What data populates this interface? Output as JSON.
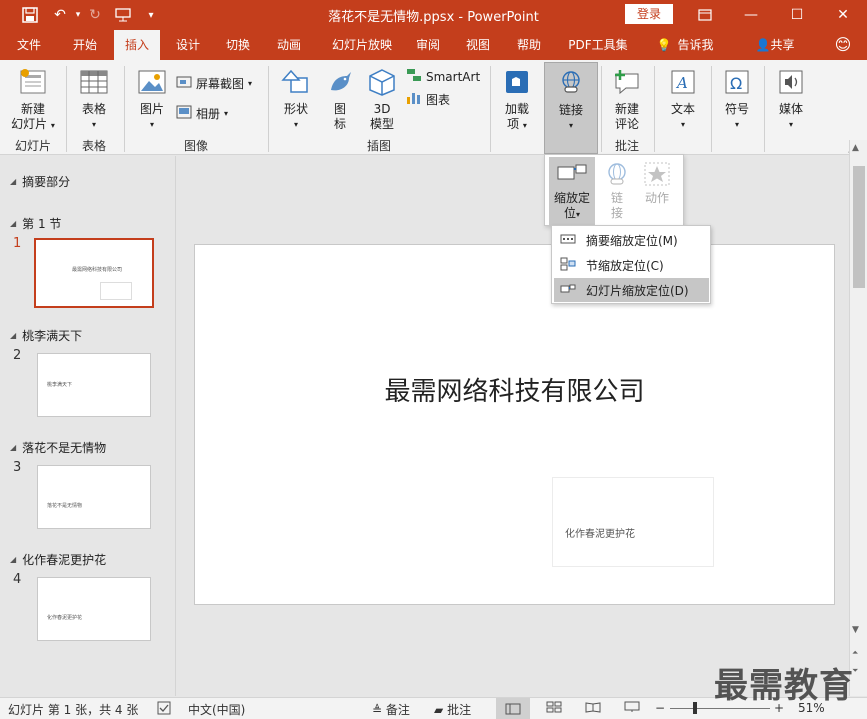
{
  "titlebar": {
    "title": "落花不是无情物.ppsx  -  PowerPoint",
    "login": "登录"
  },
  "tabs": [
    "文件",
    "开始",
    "插入",
    "设计",
    "切换",
    "动画",
    "幻灯片放映",
    "审阅",
    "视图",
    "帮助",
    "PDF工具集",
    "告诉我",
    "共享"
  ],
  "ribbon": {
    "new_slide": "新建\n幻灯片",
    "new_slide_l1": "新建",
    "new_slide_l2": "幻灯片",
    "table": "表格",
    "picture": "图片",
    "screenshot": "屏幕截图",
    "album": "相册",
    "shapes": "形状",
    "icons_l1": "图",
    "icons_l2": "标",
    "model_l1": "3D",
    "model_l2": "模型",
    "smartart": "SmartArt",
    "chart": "图表",
    "addin_l1": "加载",
    "addin_l2": "项",
    "link": "链接",
    "comment_l1": "新建",
    "comment_l2": "评论",
    "text": "文本",
    "symbol": "符号",
    "media": "媒体",
    "group_slides": "幻灯片",
    "group_tables": "表格",
    "group_images": "图像",
    "group_illustrations": "插图",
    "group_comments": "批注"
  },
  "link_dropdown": {
    "zoom_l1": "缩放定",
    "zoom_l2": "位",
    "hyperlink_l1": "链",
    "hyperlink_l2": "接",
    "action": "动作"
  },
  "zoom_menu": {
    "summary": "摘要缩放定位(M)",
    "section": "节缩放定位(C)",
    "slide": "幻灯片缩放定位(D)"
  },
  "sections": [
    {
      "name": "摘要部分"
    },
    {
      "name": "第 1 节"
    },
    {
      "name": "桃李满天下"
    },
    {
      "name": "落花不是无情物"
    },
    {
      "name": "化作春泥更护花"
    }
  ],
  "thumbnails": [
    {
      "num": "1",
      "text": "最需网络科技有限公司"
    },
    {
      "num": "2",
      "text": "桃李满天下"
    },
    {
      "num": "3",
      "text": "落花不是无情物"
    },
    {
      "num": "4",
      "text": "化作春泥更护花"
    }
  ],
  "slide": {
    "title": "最需网络科技有限公司",
    "zoom_text": "化作春泥更护花"
  },
  "status": {
    "slide_info": "幻灯片 第 1 张，共 4 张",
    "language": "中文(中国)",
    "notes": "备注",
    "comments": "批注",
    "zoom": "51%"
  },
  "watermark": "最需教育",
  "colors": {
    "accent": "#c43e1c"
  }
}
